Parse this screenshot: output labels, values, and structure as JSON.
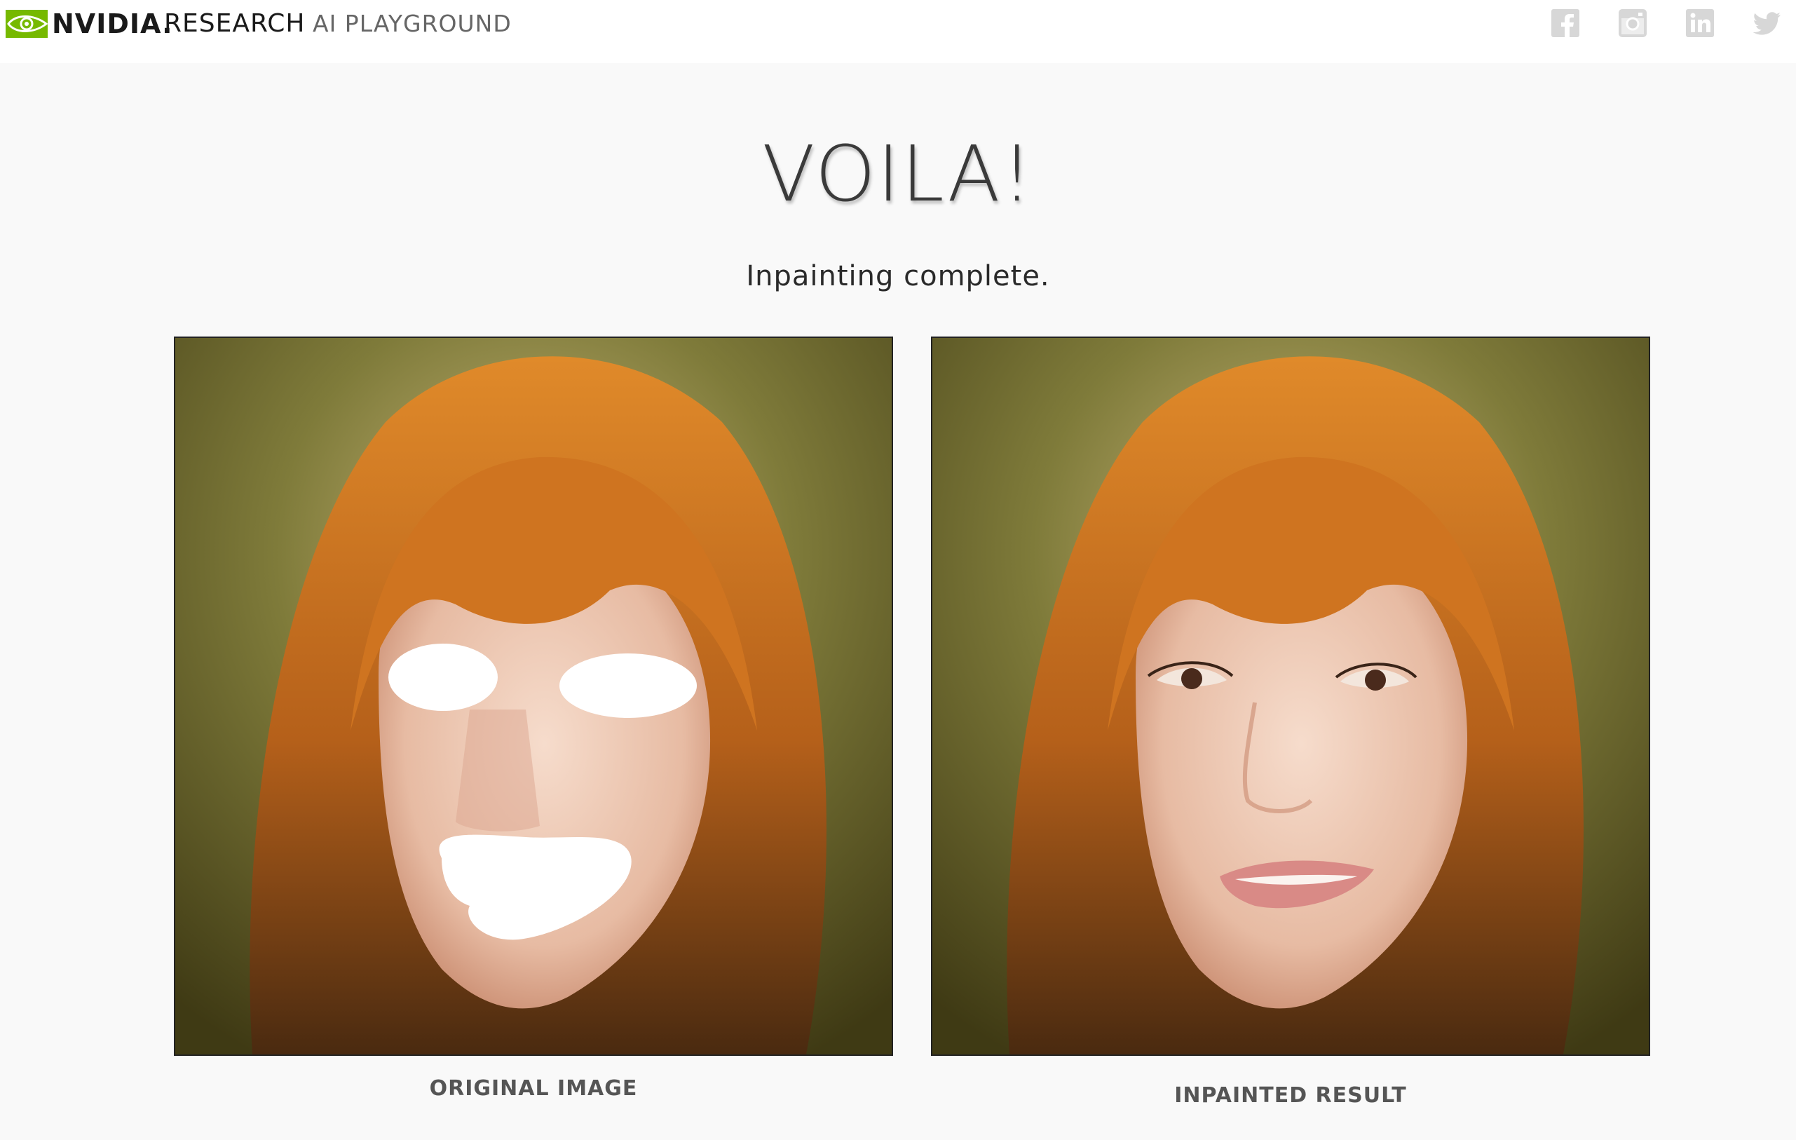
{
  "header": {
    "brand": "NVIDIA.",
    "research": "RESEARCH",
    "product": "AI PLAYGROUND",
    "brand_color": "#76b900",
    "social_icons": [
      "facebook-icon",
      "instagram-icon",
      "linkedin-icon",
      "twitter-icon"
    ]
  },
  "main": {
    "title": "VOILA!",
    "subtitle": "Inpainting complete.",
    "original_caption": "ORIGINAL IMAGE",
    "result_caption": "INPAINTED RESULT"
  }
}
